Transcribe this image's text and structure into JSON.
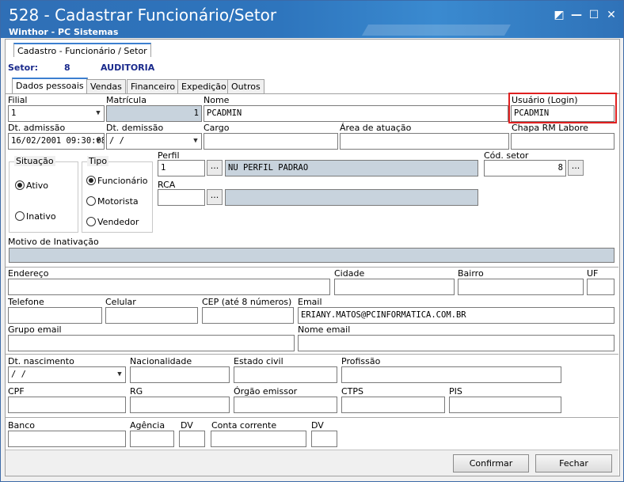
{
  "window": {
    "title": "528 - Cadastrar Funcionário/Setor",
    "subtitle": "Winthor - PC Sistemas",
    "restore_glyph": "◩",
    "minimize_glyph": "—",
    "maximize_glyph": "☐",
    "close_glyph": "✕"
  },
  "top_tab": "Cadastro - Funcionário / Setor",
  "setor": {
    "label": "Setor:",
    "code": "8",
    "name": "AUDITORIA"
  },
  "tabs": [
    "Dados pessoais",
    "Vendas",
    "Financeiro",
    "Expedição",
    "Outros"
  ],
  "fields": {
    "filial": {
      "label": "Filial",
      "value": "1"
    },
    "matricula": {
      "label": "Matrícula",
      "value": "1"
    },
    "nome": {
      "label": "Nome",
      "value": "PCADMIN"
    },
    "usuario": {
      "label": "Usuário (Login)",
      "value": "PCADMIN"
    },
    "dt_admissao": {
      "label": "Dt. admissão",
      "value": "16/02/2001 09:30:08"
    },
    "dt_demissao": {
      "label": "Dt.  demissão",
      "value": " / /"
    },
    "cargo": {
      "label": "Cargo",
      "value": ""
    },
    "area_atuacao": {
      "label": "Área de atuação",
      "value": ""
    },
    "chapa": {
      "label": "Chapa RM Labore",
      "value": ""
    },
    "perfil": {
      "label": "Perfil",
      "code": "1",
      "desc": "NU  PERFIL PADRAO"
    },
    "cod_setor": {
      "label": "Cód. setor",
      "value": "8"
    },
    "rca": {
      "label": "RCA",
      "code": "",
      "desc": ""
    },
    "motivo_inativacao": {
      "label": "Motivo de Inativação",
      "value": ""
    },
    "endereco": {
      "label": "Endereço",
      "value": ""
    },
    "cidade": {
      "label": "Cidade",
      "value": ""
    },
    "bairro": {
      "label": "Bairro",
      "value": ""
    },
    "uf": {
      "label": "UF",
      "value": ""
    },
    "telefone": {
      "label": "Telefone",
      "value": ""
    },
    "celular": {
      "label": "Celular",
      "value": ""
    },
    "cep": {
      "label": "CEP (até 8 números)",
      "value": ""
    },
    "email": {
      "label": "Email",
      "value": "ERIANY.MATOS@PCINFORMATICA.COM.BR"
    },
    "grupo_email": {
      "label": "Grupo email",
      "value": ""
    },
    "nome_email": {
      "label": "Nome email",
      "value": ""
    },
    "dt_nascimento": {
      "label": "Dt. nascimento",
      "value": " / /"
    },
    "nacionalidade": {
      "label": "Nacionalidade",
      "value": ""
    },
    "estado_civil": {
      "label": "Estado civil",
      "value": ""
    },
    "profissao": {
      "label": "Profissão",
      "value": ""
    },
    "cpf": {
      "label": "CPF",
      "value": ""
    },
    "rg": {
      "label": "RG",
      "value": ""
    },
    "orgao_emissor": {
      "label": "Órgão emissor",
      "value": ""
    },
    "ctps": {
      "label": "CTPS",
      "value": ""
    },
    "pis": {
      "label": "PIS",
      "value": ""
    },
    "banco": {
      "label": "Banco",
      "value": ""
    },
    "agencia": {
      "label": "Agência",
      "value": ""
    },
    "dv1": {
      "label": "DV",
      "value": ""
    },
    "conta_corrente": {
      "label": "Conta corrente",
      "value": ""
    },
    "dv2": {
      "label": "DV",
      "value": ""
    }
  },
  "situacao": {
    "label": "Situação",
    "options": [
      "Ativo",
      "Inativo"
    ],
    "selected": "Ativo"
  },
  "tipo": {
    "label": "Tipo",
    "options": [
      "Funcionário",
      "Motorista",
      "Vendedor"
    ],
    "selected": "Funcionário"
  },
  "buttons": {
    "confirmar": "Confirmar",
    "fechar": "Fechar",
    "ellipsis": "..."
  },
  "colors": {
    "title_bar": "#2f6fb6",
    "highlight": "#e02020",
    "disabled_field": "#c8d3dd",
    "setor_text": "#1a2a8c"
  }
}
